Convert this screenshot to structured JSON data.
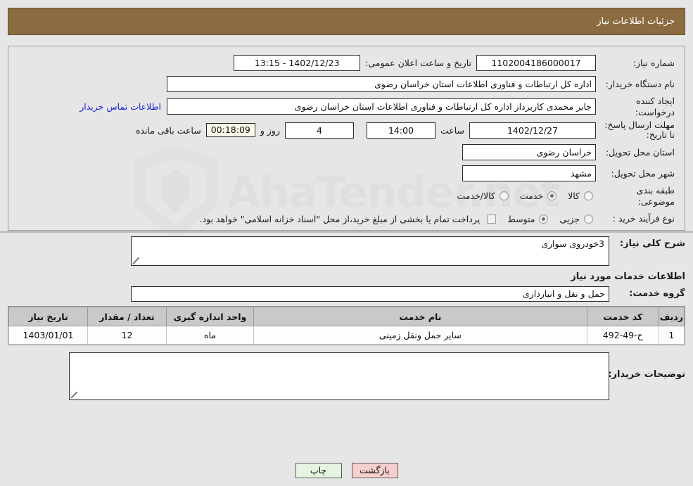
{
  "header": {
    "title": "جزئیات اطلاعات نیاز"
  },
  "watermark": {
    "text": "AhaTender",
    "suffix": ".net"
  },
  "form": {
    "need_number_label": "شماره نیاز:",
    "need_number_value": "1102004186000017",
    "announce_datetime_label": "تاریخ و ساعت اعلان عمومی:",
    "announce_datetime_value": "1402/12/23 - 13:15",
    "buyer_org_label": "نام دستگاه خریدار:",
    "buyer_org_value": "اداره کل ارتباطات و فناوری اطلاعات استان خراسان رضوی",
    "requester_label": "ایجاد کننده درخواست:",
    "requester_value": "جابر محمدی کاربرداز اداره کل ارتباطات و فناوری اطلاعات استان خراسان رضوی",
    "contact_link": "اطلاعات تماس خریدار",
    "deadline_label": "مهلت ارسال پاسخ: تا تاریخ:",
    "deadline_date": "1402/12/27",
    "time_word": "ساعت",
    "deadline_time": "14:00",
    "days_remaining": "4",
    "days_word": "روز و",
    "countdown": "00:18:09",
    "remaining_word": "ساعت باقی مانده",
    "province_label": "استان محل تحویل:",
    "province_value": "خراسان رضوی",
    "city_label": "شهر محل تحویل:",
    "city_value": "مشهد",
    "category_label": "طبقه بندی موضوعی:",
    "category_options": [
      {
        "label": "کالا",
        "selected": false
      },
      {
        "label": "خدمت",
        "selected": true
      },
      {
        "label": "کالا/خدمت",
        "selected": false
      }
    ],
    "process_label": "نوع فرآیند خرید :",
    "process_options": [
      {
        "label": "جزیی",
        "selected": false
      },
      {
        "label": "متوسط",
        "selected": true
      }
    ],
    "payment_note": "پرداخت تمام یا بخشی از مبلغ خرید،از محل \"اسناد خزانه اسلامی\" خواهد بود."
  },
  "lower": {
    "general_desc_label": "شرح کلی نیاز:",
    "general_desc_value": "3خودروی سواری",
    "services_section_title": "اطلاعات خدمات مورد نیاز",
    "service_group_label": "گروه خدمت:",
    "service_group_value": "حمل و نقل و انبارداری",
    "buyer_notes_label": "توضیحات خریدار:",
    "buyer_notes_value": ""
  },
  "table": {
    "columns": [
      "ردیف",
      "کد خدمت",
      "نام خدمت",
      "واحد اندازه گیری",
      "تعداد / مقدار",
      "تاریخ نیاز"
    ],
    "rows": [
      {
        "row_no": "1",
        "service_code": "ح-49-492",
        "service_name": "سایر حمل ونقل زمینی",
        "unit": "ماه",
        "quantity": "12",
        "need_date": "1403/01/01"
      }
    ]
  },
  "footer": {
    "back_label": "بازگشت",
    "print_label": "چاپ"
  },
  "colors": {
    "header_bg": "#8b6b40",
    "link": "#1b23d8",
    "back_btn": "#f8cfcf",
    "print_btn": "#e6f5e2",
    "table_header": "#c9c9c9",
    "page_bg": "#e6e6e6"
  }
}
